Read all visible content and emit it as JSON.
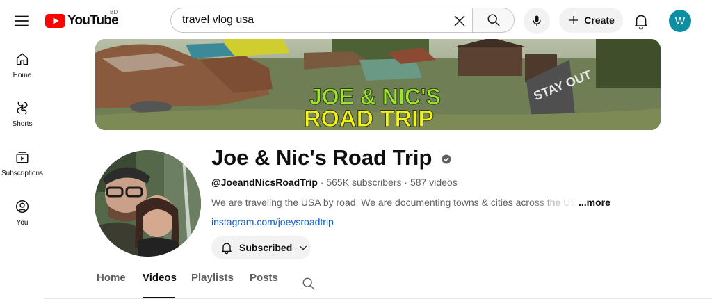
{
  "header": {
    "logo_text": "YouTube",
    "region": "BD",
    "search": {
      "value": "travel vlog usa",
      "placeholder": "Search"
    },
    "create_label": "Create",
    "account_initial": "W",
    "account_color": "#0e8ea3"
  },
  "sidebar": {
    "items": [
      {
        "label": "Home",
        "icon": "home-icon"
      },
      {
        "label": "Shorts",
        "icon": "shorts-icon"
      },
      {
        "label": "Subscriptions",
        "icon": "subscriptions-icon"
      },
      {
        "label": "You",
        "icon": "you-icon"
      }
    ]
  },
  "banner": {
    "line1": "JOE & NIC'S",
    "line2": "ROAD TRIP",
    "sign_text": "STAY OUT"
  },
  "channel": {
    "name": "Joe & Nic's Road Trip",
    "verified": true,
    "handle": "@JoeandNicsRoadTrip",
    "subscribers": "565K subscribers",
    "videos": "587 videos",
    "separator": "·",
    "description": "We are traveling the USA by road. We are documenting towns & cities across the USA, most",
    "more_label": "...more",
    "link": "instagram.com/joeysroadtrip",
    "subscribe_label": "Subscribed"
  },
  "tabs": {
    "items": [
      "Home",
      "Videos",
      "Playlists",
      "Posts"
    ],
    "active": "Videos"
  },
  "colors": {
    "brand_red": "#ff0000",
    "link_blue": "#065fd4",
    "banner_yellow": "#f4f01a",
    "banner_green": "#9be52d"
  }
}
